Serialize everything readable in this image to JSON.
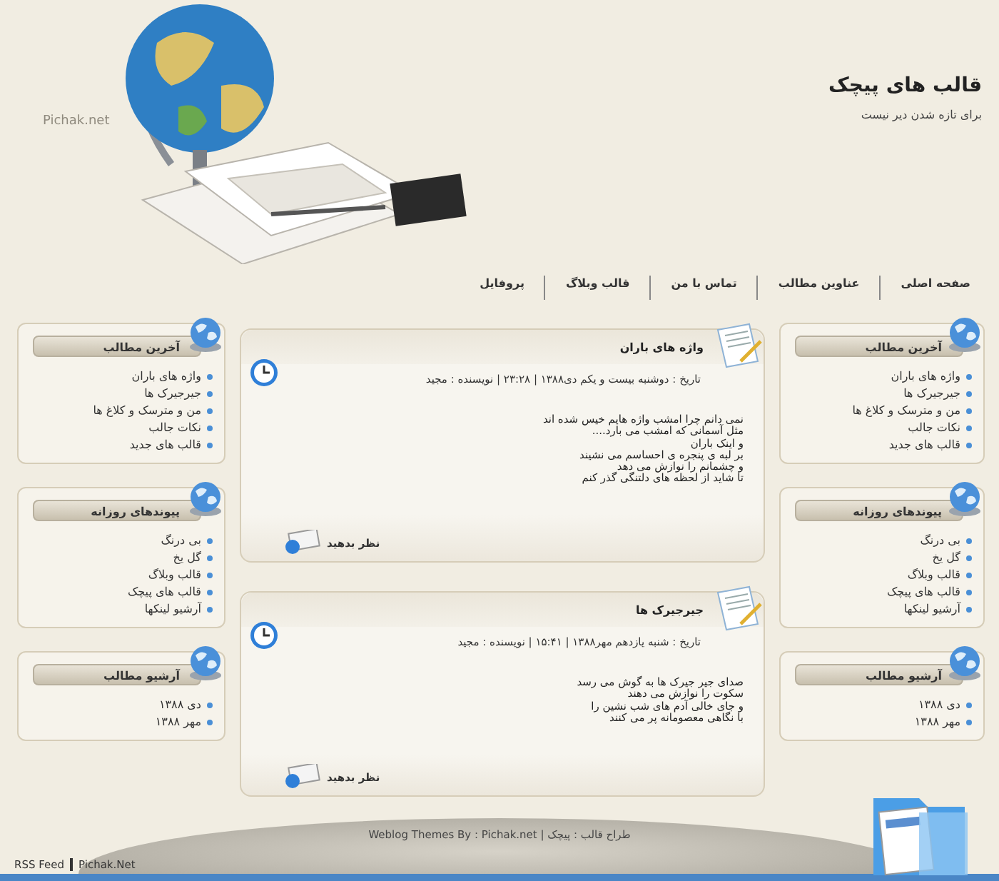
{
  "header": {
    "logo": "Pichak.net",
    "title": "قالب های پیچک",
    "tagline": "برای تازه شدن دیر نیست"
  },
  "nav": [
    {
      "label": "صفحه اصلی"
    },
    {
      "label": "عناوین مطالب"
    },
    {
      "label": "تماس با من"
    },
    {
      "label": "قالب وبلاگ"
    },
    {
      "label": "پروفایل"
    }
  ],
  "right_sidebar": [
    {
      "title": "آخرین مطالب",
      "items": [
        "واژه های باران",
        "جیرجیرک ها",
        "من و مترسک و کلاغ ها",
        "نکات جالب",
        "قالب های جدید"
      ]
    },
    {
      "title": "پیوندهای روزانه",
      "items": [
        "بی درنگ",
        "گل یخ",
        "قالب وبلاگ",
        "قالب های پیچک",
        "آرشیو لینکها"
      ]
    },
    {
      "title": "آرشیو مطالب",
      "items": [
        "دی ۱۳۸۸",
        "مهر ۱۳۸۸"
      ]
    }
  ],
  "posts": [
    {
      "title": "واژه های باران",
      "meta": "تاریخ : دوشنبه بیست و یکم دی۱۳۸۸ | ۲۳:۲۸ | نویسنده : مجید",
      "body": [
        "نمی دانم چرا امشب واژه هایم خیس شده اند",
        "مثل آسمانی که امشب می بارد....",
        "و اینک باران",
        "بر لبه ی پنجره ی احساسم می نشیند",
        "و چشمانم را نوازش می دهد",
        "تا شاید از لحظه های دلتنگی گذر کنم"
      ],
      "comment_link": "نظر بدهید"
    },
    {
      "title": "جیرجیرک ها",
      "meta": "تاریخ : شنبه یازدهم مهر۱۳۸۸ | ۱۵:۴۱ | نویسنده : مجید",
      "body": [
        "صدای جیر جیرک ها به گوش می رسد",
        "سکوت را نوازش می دهند",
        "و جای خالی آدم های شب نشین را",
        "با نگاهی معصومانه پر می کنند"
      ],
      "comment_link": "نظر بدهید"
    }
  ],
  "left_sidebar": [
    {
      "title": "آخرین مطالب",
      "items": [
        "واژه های باران",
        "جیرجیرک ها",
        "من و مترسک و کلاغ ها",
        "نکات جالب",
        "قالب های جدید"
      ]
    },
    {
      "title": "پیوندهای روزانه",
      "items": [
        "بی درنگ",
        "گل یخ",
        "قالب وبلاگ",
        "قالب های پیچک",
        "آرشیو لینکها"
      ]
    },
    {
      "title": "آرشیو مطالب",
      "items": [
        "دی ۱۳۸۸",
        "مهر ۱۳۸۸"
      ]
    }
  ],
  "footer": {
    "credit": "Weblog Themes By : Pichak.net | طراح قالب : پیچک",
    "links": [
      "Pichak.Net",
      "RSS Feed"
    ]
  }
}
